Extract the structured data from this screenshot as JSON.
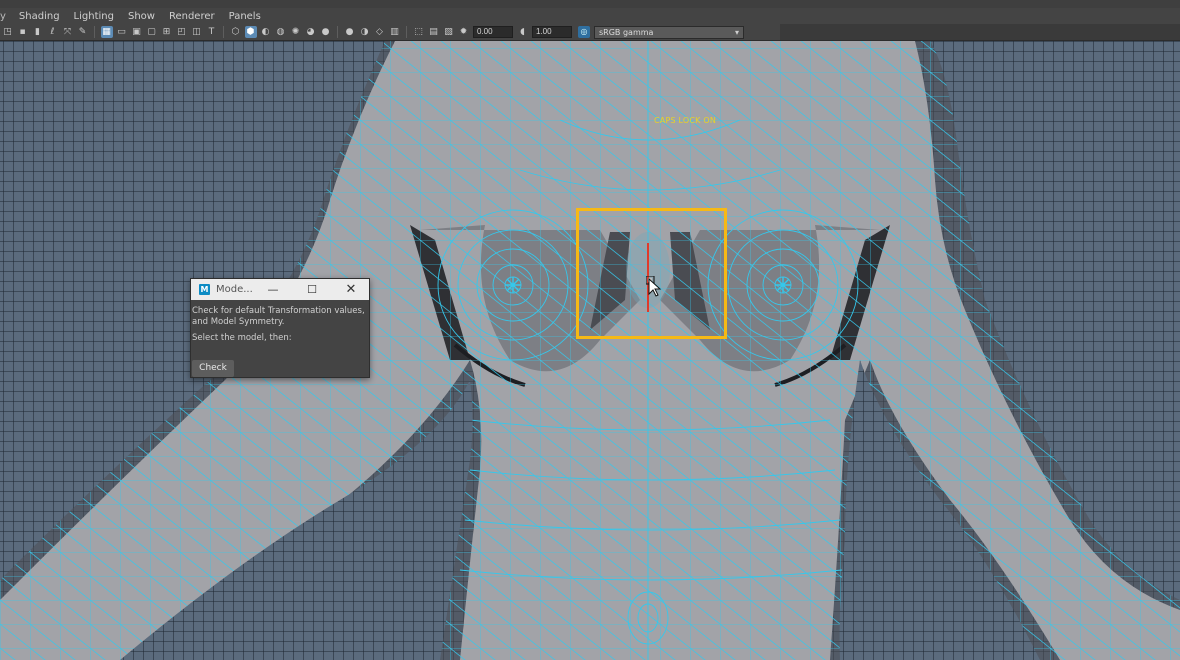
{
  "menubar": {
    "lead": "y",
    "items": [
      "Shading",
      "Lighting",
      "Show",
      "Renderer",
      "Panels"
    ]
  },
  "toolbar": {
    "exposure_value": "0.00",
    "gamma_value": "1.00",
    "color_space": "sRGB gamma"
  },
  "viewport": {
    "hud_caps_lock": "CAPS LOCK ON"
  },
  "modelcheck_window": {
    "title": "Mode...",
    "description_line1": "Check for default Transformation values,",
    "description_line2": "and Model Symmetry.",
    "instruction": "Select the model, then:",
    "check_button": "Check"
  },
  "colors": {
    "viewport_background": "#5b6b7d",
    "wireframe": "#35c8ec",
    "highlight": "#f6b915",
    "symmetry_line": "#e03a2a",
    "hud_text": "#e8d324"
  },
  "icons": [
    "select-icon",
    "lasso-icon",
    "paint-icon",
    "camera-icon",
    "grid-icon",
    "film-gate-icon",
    "wireframe-icon",
    "smooth-shade-icon",
    "textured-icon",
    "lights-icon",
    "shadows-icon",
    "xray-icon",
    "isolate-icon",
    "exposure-icon",
    "gamma-icon",
    "color-management-icon"
  ]
}
